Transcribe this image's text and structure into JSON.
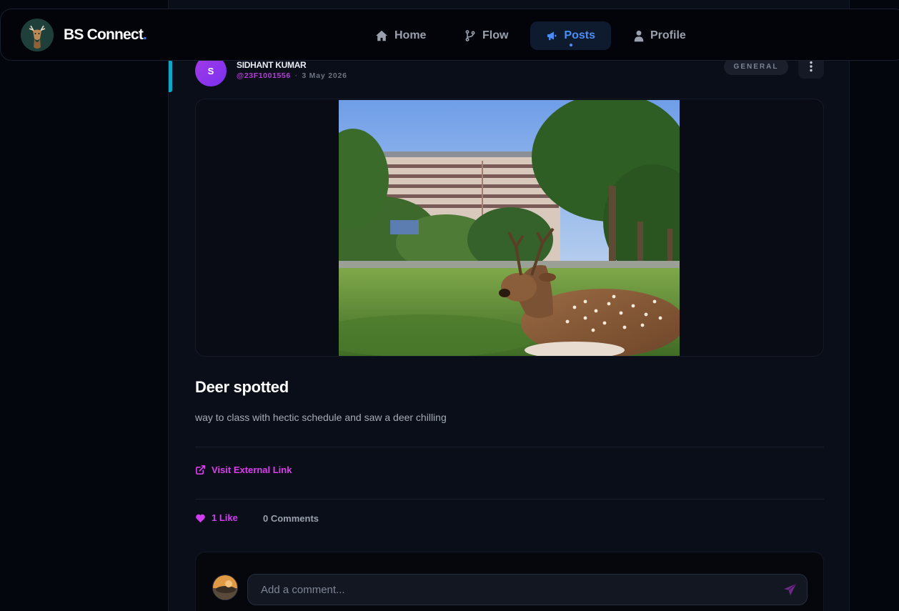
{
  "brand": {
    "name": "BS Connect",
    "dot": ".",
    "logo_icon": "deer-logo-icon"
  },
  "nav": {
    "items": [
      {
        "label": "Home",
        "icon": "home-icon"
      },
      {
        "label": "Flow",
        "icon": "git-branch-icon"
      },
      {
        "label": "Posts",
        "icon": "megaphone-icon",
        "active": true
      },
      {
        "label": "Profile",
        "icon": "user-icon"
      }
    ]
  },
  "post": {
    "author": {
      "initial": "S",
      "name": "SIDHANT KUMAR",
      "handle": "@23F1001556",
      "date": "3 May 2026"
    },
    "category": "GENERAL",
    "title": "Deer spotted",
    "body": "way to class with hectic schedule and saw a deer chilling",
    "external_link_label": "Visit External Link",
    "likes_label": "1 Like",
    "comments_label": "0 Comments"
  },
  "comment": {
    "placeholder": "Add a comment..."
  },
  "colors": {
    "accent_blue": "#4a8ff7",
    "accent_magenta": "#d13cf0",
    "accent_cyan": "#0ea5c6",
    "background": "#0a0e18"
  }
}
